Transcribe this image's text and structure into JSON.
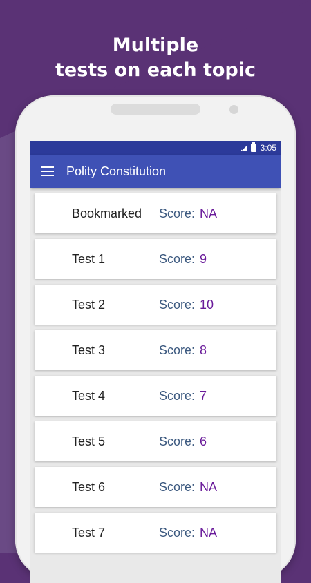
{
  "promo": {
    "line1": "Multiple",
    "line2": "tests on each topic"
  },
  "status_bar": {
    "time": "3:05"
  },
  "app_bar": {
    "title": "Polity Constitution"
  },
  "tests": [
    {
      "name": "Bookmarked",
      "score_label": "Score:",
      "score": "NA"
    },
    {
      "name": "Test 1",
      "score_label": "Score:",
      "score": "9"
    },
    {
      "name": "Test 2",
      "score_label": "Score:",
      "score": "10"
    },
    {
      "name": "Test 3",
      "score_label": "Score:",
      "score": "8"
    },
    {
      "name": "Test 4",
      "score_label": "Score:",
      "score": "7"
    },
    {
      "name": "Test 5",
      "score_label": "Score:",
      "score": "6"
    },
    {
      "name": "Test 6",
      "score_label": "Score:",
      "score": "NA"
    },
    {
      "name": "Test 7",
      "score_label": "Score:",
      "score": "NA"
    }
  ],
  "colors": {
    "background": "#5a3275",
    "app_bar": "#3f51b5",
    "status_bar": "#2c3a9a",
    "score_label": "#3d5a80",
    "score_value": "#6a1b9a"
  },
  "icons": {
    "menu": "menu-icon",
    "signal": "signal-icon",
    "battery": "battery-icon"
  }
}
